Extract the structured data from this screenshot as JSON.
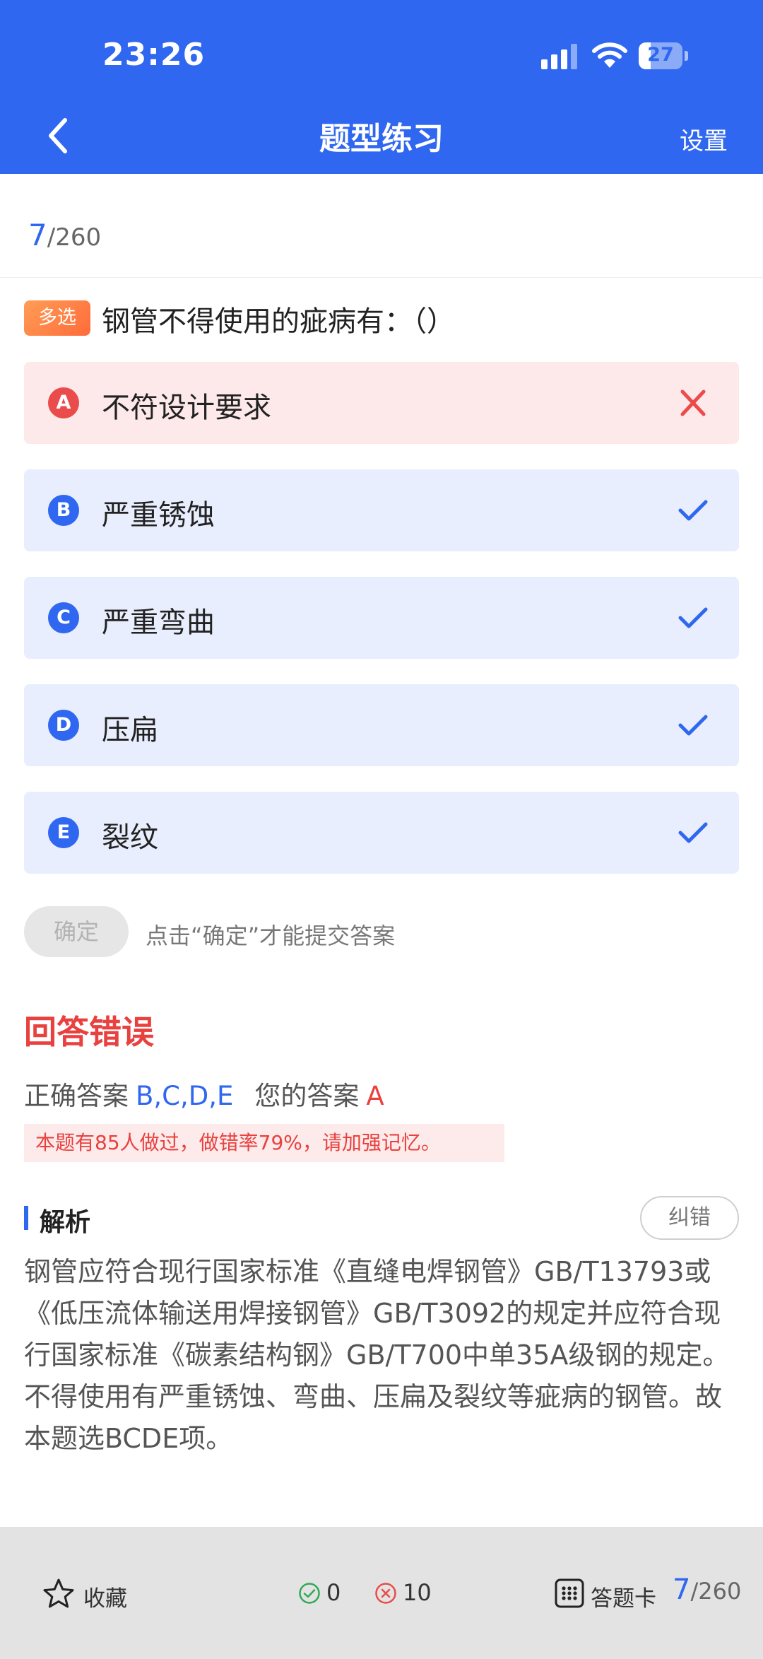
{
  "status": {
    "time": "23:26",
    "battery": "27",
    "battery_level": 0.27
  },
  "nav": {
    "title": "题型练习",
    "settings": "设置"
  },
  "progress": {
    "current": "7",
    "total": "/260"
  },
  "question": {
    "type": "多选",
    "text": "钢管不得使用的疵病有：（）"
  },
  "options": [
    {
      "letter": "A",
      "text": "不符设计要求",
      "state": "wrong"
    },
    {
      "letter": "B",
      "text": "严重锈蚀",
      "state": "correct"
    },
    {
      "letter": "C",
      "text": "严重弯曲",
      "state": "correct"
    },
    {
      "letter": "D",
      "text": "压扁",
      "state": "correct"
    },
    {
      "letter": "E",
      "text": "裂纹",
      "state": "correct"
    }
  ],
  "confirm": {
    "label": "确定",
    "hint": "点击“确定”才能提交答案"
  },
  "result": {
    "title": "回答错误",
    "correct_label": "正确答案",
    "correct_value": "B,C,D,E",
    "yours_label": "您的答案",
    "yours_value": "A",
    "stat_note": "本题有85人做过，做错率79%，请加强记忆。"
  },
  "analysis": {
    "title": "解析",
    "report_label": "纠错",
    "text": "钢管应符合现行国家标准《直缝电焊钢管》GB/T13793或《低压流体输送用焊接钢管》GB/T3092的规定并应符合现行国家标准《碳素结构钢》GB/T700中单35A级钢的规定。不得使用有严重锈蚀、弯曲、压扁及裂纹等疵病的钢管。故本题选BCDE项。"
  },
  "bottom": {
    "favorite_label": "收藏",
    "correct_count": "0",
    "wrong_count": "10",
    "card_label": "答题卡",
    "current": "7",
    "total": "/260"
  },
  "colors": {
    "primary": "#2f67f0",
    "error": "#e8413f",
    "success": "#2faa56"
  },
  "icons": {
    "back": "chevron-left-icon",
    "signal": "cellular-signal-icon",
    "wifi": "wifi-icon",
    "battery": "battery-icon",
    "correct_mark": "check-icon",
    "wrong_mark": "close-icon",
    "favorite": "star-icon",
    "correct_count": "check-circle-icon",
    "wrong_count": "x-circle-icon",
    "answer_card": "grid-icon"
  }
}
